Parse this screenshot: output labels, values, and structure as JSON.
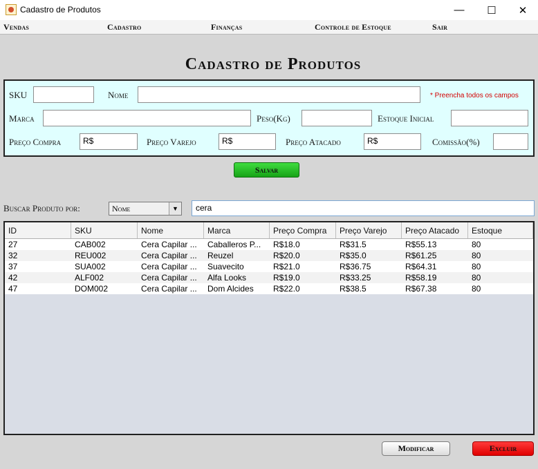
{
  "window": {
    "title": "Cadastro de Produtos",
    "minimize": "—",
    "maximize": "☐",
    "close": "✕"
  },
  "menu": [
    "Vendas",
    "Cadastro",
    "Finanças",
    "Controle de Estoque",
    "Sair"
  ],
  "heading": "Cadastro de Produtos",
  "form": {
    "sku_label": "SKU",
    "nome_label": "Nome",
    "required_note": "* Preencha todos os campos",
    "marca_label": "Marca",
    "peso_label": "Peso(Kg)",
    "estoque_label": "Estoque Inicial",
    "preco_compra_label": "Preço Compra",
    "preco_compra_value": "R$",
    "preco_varejo_label": "Preço Varejo",
    "preco_varejo_value": "R$",
    "preco_atacado_label": "Preço Atacado",
    "preco_atacado_value": "R$",
    "comissao_label": "Comissão(%)",
    "save_label": "Salvar"
  },
  "search": {
    "label": "Buscar Produto por:",
    "selected": "Nome",
    "query": "cera"
  },
  "table": {
    "columns": [
      "ID",
      "SKU",
      "Nome",
      "Marca",
      "Preço Compra",
      "Preço Varejo",
      "Preço Atacado",
      "Estoque"
    ],
    "rows": [
      [
        "27",
        "CAB002",
        "Cera Capilar ...",
        "Caballeros P...",
        "R$18.0",
        "R$31.5",
        "R$55.13",
        "80"
      ],
      [
        "32",
        "REU002",
        "Cera Capilar ...",
        "Reuzel",
        "R$20.0",
        "R$35.0",
        "R$61.25",
        "80"
      ],
      [
        "37",
        "SUA002",
        "Cera Capilar ...",
        "Suavecito",
        "R$21.0",
        "R$36.75",
        "R$64.31",
        "80"
      ],
      [
        "42",
        "ALF002",
        "Cera Capilar ...",
        "Alfa Looks",
        "R$19.0",
        "R$33.25",
        "R$58.19",
        "80"
      ],
      [
        "47",
        "DOM002",
        "Cera Capilar ...",
        "Dom Alcides",
        "R$22.0",
        "R$38.5",
        "R$67.38",
        "80"
      ]
    ]
  },
  "actions": {
    "modify_label": "Modificar",
    "delete_label": "Excluir"
  },
  "colors": {
    "form_bg": "#e0ffff",
    "save": "#22bb22",
    "delete": "#ff1a1a",
    "warning": "#d20000"
  }
}
